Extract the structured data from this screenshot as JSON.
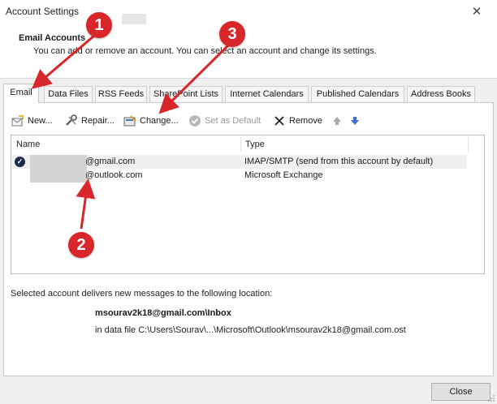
{
  "window": {
    "title": "Account Settings",
    "close_glyph": "✕"
  },
  "header": {
    "title": "Email Accounts",
    "description": "You can add or remove an account. You can select an account and change its settings."
  },
  "tabs": [
    {
      "label": "Email",
      "active": true
    },
    {
      "label": "Data Files"
    },
    {
      "label": "RSS Feeds"
    },
    {
      "label": "SharePoint Lists"
    },
    {
      "label": "Internet Calendars"
    },
    {
      "label": "Published Calendars"
    },
    {
      "label": "Address Books"
    }
  ],
  "toolbar": {
    "new_label": "New...",
    "repair_label": "Repair...",
    "change_label": "Change...",
    "set_default_label": "Set as Default",
    "remove_label": "Remove"
  },
  "accounts": {
    "columns": {
      "name": "Name",
      "type": "Type"
    },
    "rows": [
      {
        "name": "@gmail.com",
        "type": "IMAP/SMTP (send from this account by default)",
        "default": true
      },
      {
        "name": "@outlook.com",
        "type": "Microsoft Exchange",
        "default": false
      }
    ]
  },
  "delivery": {
    "label": "Selected account delivers new messages to the following location:",
    "folder": "msourav2k18@gmail.com\\Inbox",
    "path": "in data file C:\\Users\\Sourav\\...\\Microsoft\\Outlook\\msourav2k18@gmail.com.ost"
  },
  "footer": {
    "close_label": "Close"
  },
  "annotations": {
    "badge_1": "1",
    "badge_2": "2",
    "badge_3": "3",
    "badge_color": "#d8262a"
  }
}
